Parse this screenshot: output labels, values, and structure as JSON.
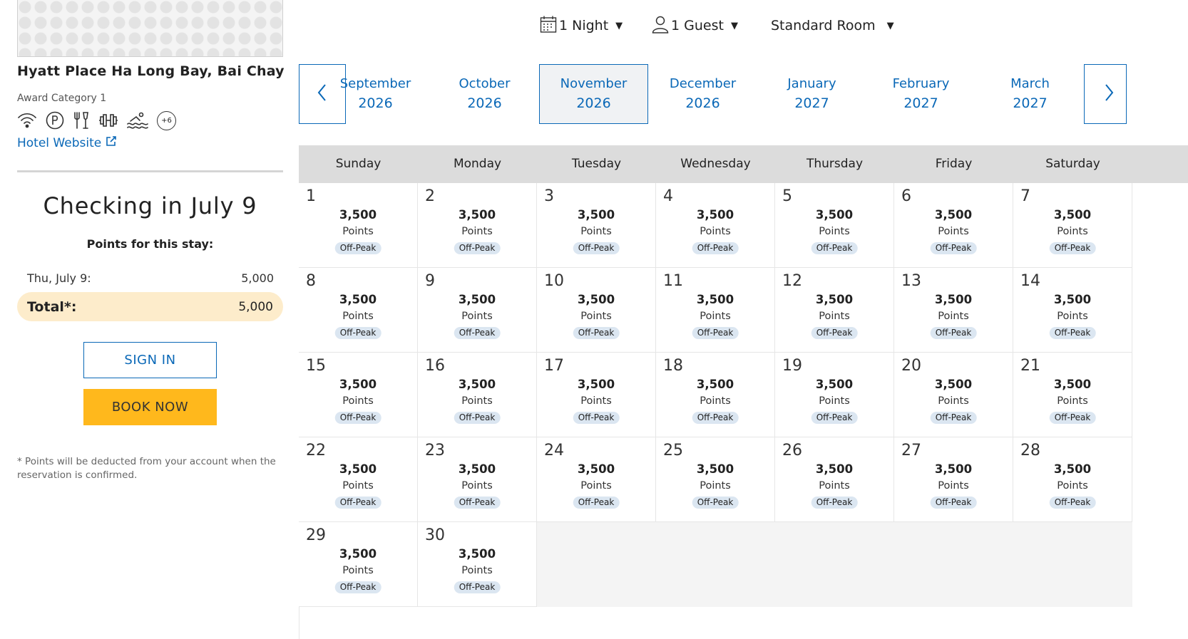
{
  "hotel": {
    "name": "Hyatt Place Ha Long Bay, Bai Chay",
    "award_category": "Award Category 1",
    "amenities": [
      "wifi-icon",
      "parking-icon",
      "restaurant-icon",
      "fitness-icon",
      "pool-icon"
    ],
    "amenities_more": "+6",
    "website_label": "Hotel Website"
  },
  "stay": {
    "title": "Checking in July 9",
    "points_label": "Points for this stay:",
    "line_label": "Thu, July 9:",
    "line_value": "5,000",
    "total_label": "Total*:",
    "total_value": "5,000"
  },
  "buttons": {
    "sign_in": "SIGN IN",
    "book_now": "BOOK NOW"
  },
  "footnote": "* Points will be deducted from your account when the reservation is confirmed.",
  "selectors": {
    "nights": "1 Night",
    "guests": "1 Guest",
    "room": "Standard Room"
  },
  "months": [
    {
      "month": "September",
      "year": "2026"
    },
    {
      "month": "October",
      "year": "2026"
    },
    {
      "month": "November",
      "year": "2026",
      "selected": true
    },
    {
      "month": "December",
      "year": "2026"
    },
    {
      "month": "January",
      "year": "2027"
    },
    {
      "month": "February",
      "year": "2027"
    },
    {
      "month": "March",
      "year": "2027"
    }
  ],
  "weekdays": [
    "Sunday",
    "Monday",
    "Tuesday",
    "Wednesday",
    "Thursday",
    "Friday",
    "Saturday"
  ],
  "calendar": {
    "first_weekday_index": 0,
    "days": [
      {
        "day": "1",
        "points": "3,500",
        "unit": "Points",
        "tier": "Off-Peak"
      },
      {
        "day": "2",
        "points": "3,500",
        "unit": "Points",
        "tier": "Off-Peak"
      },
      {
        "day": "3",
        "points": "3,500",
        "unit": "Points",
        "tier": "Off-Peak"
      },
      {
        "day": "4",
        "points": "3,500",
        "unit": "Points",
        "tier": "Off-Peak"
      },
      {
        "day": "5",
        "points": "3,500",
        "unit": "Points",
        "tier": "Off-Peak"
      },
      {
        "day": "6",
        "points": "3,500",
        "unit": "Points",
        "tier": "Off-Peak"
      },
      {
        "day": "7",
        "points": "3,500",
        "unit": "Points",
        "tier": "Off-Peak"
      },
      {
        "day": "8",
        "points": "3,500",
        "unit": "Points",
        "tier": "Off-Peak"
      },
      {
        "day": "9",
        "points": "3,500",
        "unit": "Points",
        "tier": "Off-Peak"
      },
      {
        "day": "10",
        "points": "3,500",
        "unit": "Points",
        "tier": "Off-Peak"
      },
      {
        "day": "11",
        "points": "3,500",
        "unit": "Points",
        "tier": "Off-Peak"
      },
      {
        "day": "12",
        "points": "3,500",
        "unit": "Points",
        "tier": "Off-Peak"
      },
      {
        "day": "13",
        "points": "3,500",
        "unit": "Points",
        "tier": "Off-Peak"
      },
      {
        "day": "14",
        "points": "3,500",
        "unit": "Points",
        "tier": "Off-Peak"
      },
      {
        "day": "15",
        "points": "3,500",
        "unit": "Points",
        "tier": "Off-Peak"
      },
      {
        "day": "16",
        "points": "3,500",
        "unit": "Points",
        "tier": "Off-Peak"
      },
      {
        "day": "17",
        "points": "3,500",
        "unit": "Points",
        "tier": "Off-Peak"
      },
      {
        "day": "18",
        "points": "3,500",
        "unit": "Points",
        "tier": "Off-Peak"
      },
      {
        "day": "19",
        "points": "3,500",
        "unit": "Points",
        "tier": "Off-Peak"
      },
      {
        "day": "20",
        "points": "3,500",
        "unit": "Points",
        "tier": "Off-Peak"
      },
      {
        "day": "21",
        "points": "3,500",
        "unit": "Points",
        "tier": "Off-Peak"
      },
      {
        "day": "22",
        "points": "3,500",
        "unit": "Points",
        "tier": "Off-Peak"
      },
      {
        "day": "23",
        "points": "3,500",
        "unit": "Points",
        "tier": "Off-Peak"
      },
      {
        "day": "24",
        "points": "3,500",
        "unit": "Points",
        "tier": "Off-Peak"
      },
      {
        "day": "25",
        "points": "3,500",
        "unit": "Points",
        "tier": "Off-Peak"
      },
      {
        "day": "26",
        "points": "3,500",
        "unit": "Points",
        "tier": "Off-Peak"
      },
      {
        "day": "27",
        "points": "3,500",
        "unit": "Points",
        "tier": "Off-Peak"
      },
      {
        "day": "28",
        "points": "3,500",
        "unit": "Points",
        "tier": "Off-Peak"
      },
      {
        "day": "29",
        "points": "3,500",
        "unit": "Points",
        "tier": "Off-Peak"
      },
      {
        "day": "30",
        "points": "3,500",
        "unit": "Points",
        "tier": "Off-Peak"
      }
    ]
  },
  "colors": {
    "link_blue": "#0a68b7",
    "book_yellow": "#ffb81c",
    "total_bg": "#fdeccb",
    "badge_bg": "#dbe6f1",
    "header_gray": "#dcdcdc"
  }
}
